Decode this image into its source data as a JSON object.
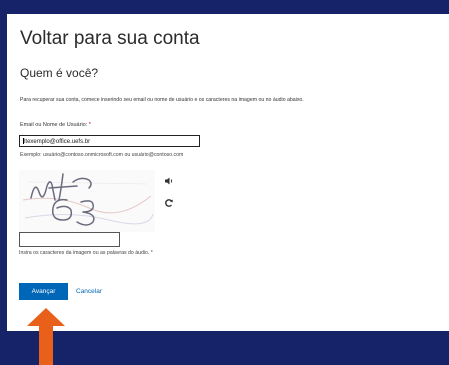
{
  "page": {
    "title": "Voltar para sua conta",
    "subtitle": "Quem é você?",
    "instructions": "Para recuperar sua conta, comece inserindo seu email ou nome de usuário e os caracteres na imagem ou no áudio abaixo."
  },
  "form": {
    "email_label": "Email ou Nome de Usuário:",
    "required_mark": "*",
    "email_value": "ltexemplo@office.uefs.br",
    "example_text": "Exemplo: usuário@contoso.onmicrosoft.com ou usuário@contoso.com",
    "captcha_text": "MT63",
    "captcha_hint": "Insira os caracteres da imagem ou as palavras do áudio. *",
    "captcha_value": ""
  },
  "actions": {
    "next_label": "Avançar",
    "cancel_label": "Cancelar"
  },
  "icons": {
    "audio": "speaker-icon",
    "refresh": "refresh-icon",
    "arrow": "up-arrow-annotation"
  },
  "colors": {
    "background": "#162368",
    "card": "#ffffff",
    "primary": "#0067b8",
    "arrow": "#e8601a",
    "required": "#cc0000"
  }
}
